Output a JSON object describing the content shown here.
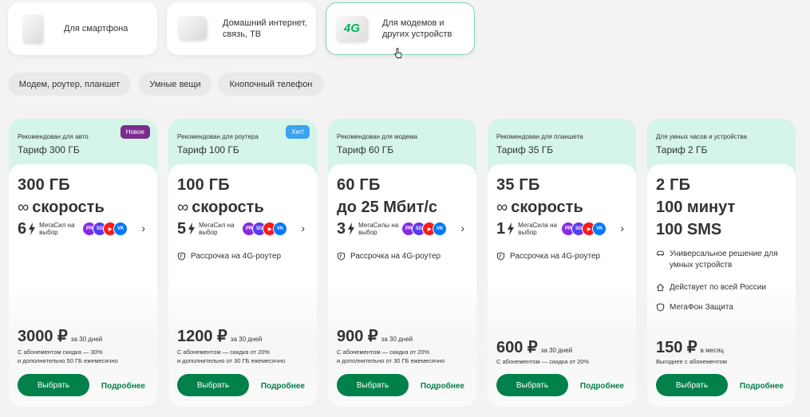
{
  "categories": [
    {
      "label": "Для смартфона",
      "icon": "smartphone-icon"
    },
    {
      "label": "Домашний интернет, связь, ТВ",
      "icon": "home-internet-icon"
    },
    {
      "label": "Для модемов и других устройств",
      "icon": "modem-4g-icon",
      "icon_text": "4G"
    }
  ],
  "chips": [
    "Модем, роутер, планшет",
    "Умные вещи",
    "Кнопочный телефон"
  ],
  "cards": [
    {
      "rec": "Рекомендован для авто",
      "name": "Тариф 300 ГБ",
      "badge": "Новое",
      "l1": "300 ГБ",
      "inf": "∞",
      "l2": "скорость",
      "ms_num": "6",
      "ms_text": "МегаСил на выбор",
      "feature": "",
      "price": "3000 ₽",
      "period": "за 30 дней",
      "note1": "С абонементом скидка — 30%",
      "note2": "и дополнительно 50 ГБ ежемесячно",
      "btn": "Выбрать",
      "more": "Подробнее"
    },
    {
      "rec": "Рекомендован для роутера",
      "name": "Тариф 100 ГБ",
      "badge": "Хит!",
      "l1": "100 ГБ",
      "inf": "∞",
      "l2": "скорость",
      "ms_num": "5",
      "ms_text": "МегаСил на выбор",
      "feature": "Рассрочка на 4G-роутер",
      "price": "1200 ₽",
      "period": "за 30 дней",
      "note1": "С абонементом — скидка от 20%",
      "note2": "и дополнительно от 30 ГБ ежемесячно",
      "btn": "Выбрать",
      "more": "Подробнее"
    },
    {
      "rec": "Рекомендован для модема",
      "name": "Тариф 60 ГБ",
      "badge": "",
      "l1": "60 ГБ",
      "l2": "до 25 Мбит/с",
      "ms_num": "3",
      "ms_text": "МегаСилы на выбор",
      "feature": "Рассрочка на 4G-роутер",
      "price": "900 ₽",
      "period": "за 30 дней",
      "note1": "С абонементом — скидка от 20%",
      "note2": "и дополнительно от 30 ГБ ежемесячно",
      "btn": "Выбрать",
      "more": "Подробнее"
    },
    {
      "rec": "Рекомендован для планшета",
      "name": "Тариф 35 ГБ",
      "badge": "",
      "l1": "35 ГБ",
      "inf": "∞",
      "l2": "скорость",
      "ms_num": "1",
      "ms_text": "МегаСила на выбор",
      "feature": "Рассрочка на 4G-роутер",
      "price": "600 ₽",
      "period": "за 30 дней",
      "note1": "С абонементом — скидка от 20%",
      "btn": "Выбрать",
      "more": "Подробнее"
    },
    {
      "rec": "Для умных часов и устройства",
      "name": "Тариф 2 ГБ",
      "badge": "",
      "l1": "2 ГБ",
      "l2": "100 минут",
      "l3": "100 SMS",
      "f1": "Универсальное решение для умных устройств",
      "f2": "Действует по всей России",
      "f3": "МегаФон Защита",
      "price": "150 ₽",
      "period": "в месяц",
      "note1": "Выгоднее с абонементом",
      "btn": "Выбрать",
      "more": "Подробнее"
    }
  ],
  "apps": [
    {
      "name": "premier",
      "label": "PR",
      "color": "#8a2be2"
    },
    {
      "name": "start",
      "label": "5G",
      "color": "#5b3cf0"
    },
    {
      "name": "youtube",
      "label": "▶",
      "color": "#ff1a1a"
    },
    {
      "name": "vk",
      "label": "VK",
      "color": "#0077ff"
    }
  ],
  "colors": {
    "accent": "#00814a",
    "mint": "#d4f5e7",
    "badge_new": "#7b2d8e",
    "badge_hit": "#3aa3f0"
  }
}
